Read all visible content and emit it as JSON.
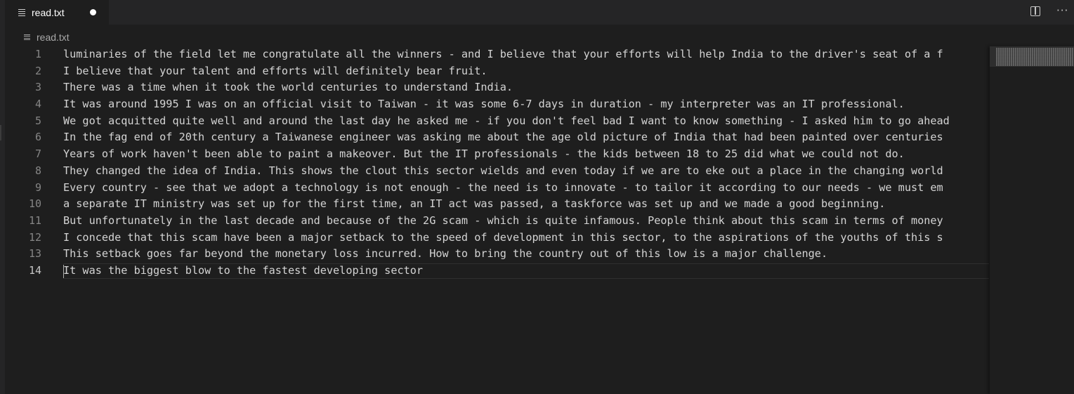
{
  "tab": {
    "label": "read.txt",
    "icon": "lines-icon",
    "dirty": true
  },
  "toolbar": {
    "split_icon": "split-editor-icon",
    "more_label": "···"
  },
  "breadcrumb": {
    "file": "read.txt",
    "icon": "lines-icon"
  },
  "editor": {
    "active_line": 14,
    "lines": [
      {
        "num": "1",
        "text": "luminaries of the field let me congratulate all the winners - and I believe that your efforts will help India to the driver's seat of a f"
      },
      {
        "num": "2",
        "text": "I believe that your talent and efforts will definitely bear fruit."
      },
      {
        "num": "3",
        "text": "There was a time when it took the world centuries to understand India."
      },
      {
        "num": "4",
        "text": "It was around 1995 I was on an official visit to Taiwan - it was some 6-7 days in duration - my interpreter was an IT professional."
      },
      {
        "num": "5",
        "text": "We got acquitted quite well and around the last day he asked me - if you don't feel bad I want to know something - I asked him to go ahead"
      },
      {
        "num": "6",
        "text": "In the fag end of 20th century a Taiwanese engineer was asking me about the age old picture of India that had been painted over centuries"
      },
      {
        "num": "7",
        "text": "Years of work haven't been able to paint a makeover. But the IT professionals - the kids between 18 to 25 did what we could not do."
      },
      {
        "num": "8",
        "text": "They changed the idea of India. This shows the clout this sector wields and even today if we are to eke out a place in the changing world"
      },
      {
        "num": "9",
        "text": "Every country - see that we adopt a technology is not enough - the need is to innovate - to tailor it according to our needs - we must em"
      },
      {
        "num": "10",
        "text": "a separate IT ministry was set up for the first time, an IT act was passed, a taskforce was set up and we made a good beginning."
      },
      {
        "num": "11",
        "text": "But unfortunately in the last decade and because of the 2G scam - which is quite infamous. People think about this scam in terms of money"
      },
      {
        "num": "12",
        "text": "I concede that this scam have been a major setback to the speed of development in this sector, to the aspirations of the youths of this s"
      },
      {
        "num": "13",
        "text": "This setback goes far beyond the monetary loss incurred. How to bring the country out of this low is a major challenge."
      },
      {
        "num": "14",
        "text": "It was the biggest blow to the fastest developing sector"
      }
    ]
  },
  "colors": {
    "editor_bg": "#1e1e1e",
    "tabbar_bg": "#252526",
    "text": "#d4d4d4",
    "line_number": "#858585",
    "active_line_number": "#c6c6c6"
  }
}
